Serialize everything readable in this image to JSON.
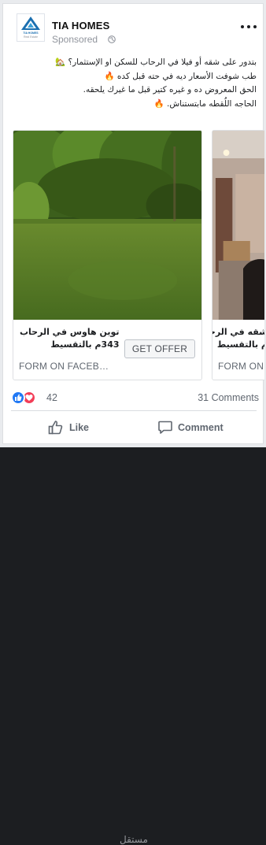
{
  "post": {
    "page_name": "TIA HOMES",
    "logo_text": "TIA HOMES",
    "logo_subtext": "Real Estate",
    "sponsored_label": "Sponsored",
    "text_lines": [
      "بتدور على شقه أو فيلا في الرحاب للسكن او الإستثمار؟ 🏡",
      "طب شوفت الأسعار ديه في حته قبل كده 🔥",
      "الحق المعروض ده و غيره كتير قبل ما غيرك يلحقه.",
      "الحاجه اللُقطه مابتستناش. 🔥"
    ]
  },
  "carousel": {
    "cards": [
      {
        "title_line1": "توين هاوس في الرحاب",
        "title_line2": "343م بالتقسيط",
        "source": "FORM ON FACEB…",
        "cta": "GET OFFER"
      },
      {
        "title_line1": "شقه في الرحاب",
        "title_line2": "م بالتقسيط",
        "source": "FORM ON"
      }
    ]
  },
  "reactions": {
    "count": "42",
    "comments": "31 Comments",
    "types": [
      "like-icon",
      "love-icon"
    ]
  },
  "actions": {
    "like": "Like",
    "comment": "Comment"
  },
  "watermark": "مستقل",
  "colors": {
    "like_blue": "#2078f4",
    "love_red": "#f33e58",
    "muted_text": "#606770",
    "brand_blue": "#1b6fb0"
  }
}
